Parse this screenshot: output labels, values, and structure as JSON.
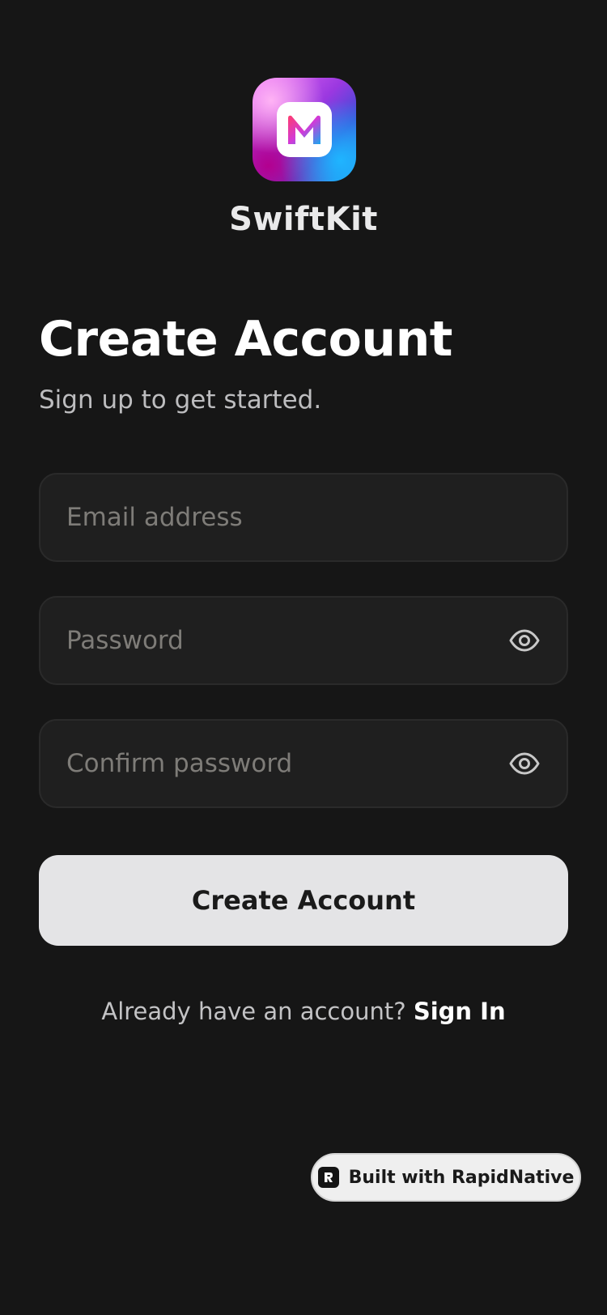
{
  "app": {
    "name": "SwiftKit",
    "logo_icon": "swiftkit-m-logo",
    "logo_colors": [
      "#f06cf5",
      "#9a38e0",
      "#18a8f0",
      "#ffffff"
    ]
  },
  "header": {
    "title": "Create Account",
    "subtitle": "Sign up to get started."
  },
  "form": {
    "email": {
      "placeholder": "Email address",
      "value": ""
    },
    "password": {
      "placeholder": "Password",
      "value": "",
      "icon": "eye-icon"
    },
    "confirm_password": {
      "placeholder": "Confirm password",
      "value": "",
      "icon": "eye-icon"
    },
    "submit_label": "Create Account"
  },
  "footer": {
    "prompt": "Already have an account?",
    "link_label": "Sign In"
  },
  "badge": {
    "label": "Built with RapidNative",
    "icon": "rapidnative-logo-icon"
  },
  "colors": {
    "background": "#161616",
    "field_background": "#1f1f1f",
    "button_background": "#e4e4e6",
    "placeholder": "#7e7c78"
  }
}
